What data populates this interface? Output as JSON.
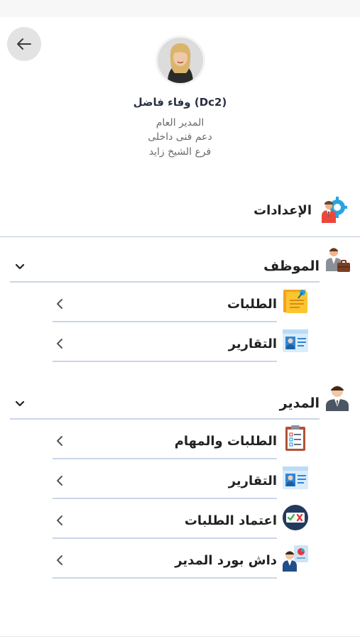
{
  "profile": {
    "name": "وفاء فاضل (Dc2)",
    "title": "المدير العام",
    "department": "دعم فنى داخلى",
    "branch": "فرع الشيخ زايد"
  },
  "settings": {
    "label": "الإعدادات",
    "icon": "settings-gear-person-icon"
  },
  "sections": [
    {
      "title": "الموظف",
      "icon": "employee-briefcase-icon",
      "items": [
        {
          "label": "الطلبات",
          "icon": "sticky-note-icon"
        },
        {
          "label": "التقارير",
          "icon": "id-card-icon"
        }
      ]
    },
    {
      "title": "المدير",
      "icon": "manager-person-icon",
      "items": [
        {
          "label": "الطلبات والمهام",
          "icon": "clipboard-checklist-icon"
        },
        {
          "label": "التقارير",
          "icon": "id-card-icon"
        },
        {
          "label": "اعتماد الطلبات",
          "icon": "approve-reject-icon"
        },
        {
          "label": "داش بورد المدير",
          "icon": "dashboard-manager-icon"
        }
      ]
    }
  ],
  "colors": {
    "accent_line": "#c9d6ea",
    "name_text": "#2a2f45",
    "back_button_bg": "#e3e3e3"
  }
}
